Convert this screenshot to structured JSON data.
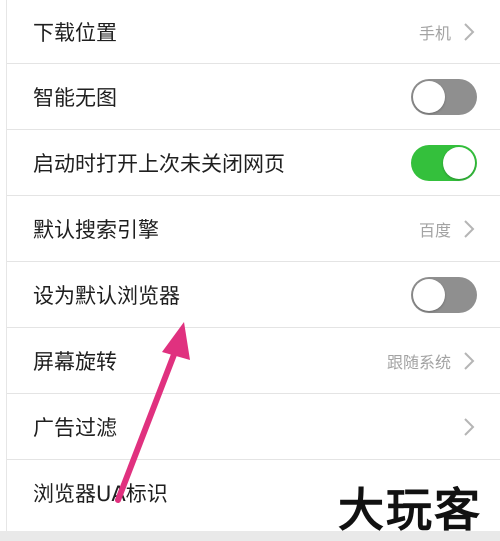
{
  "settings": {
    "items": [
      {
        "label": "下载位置",
        "value": "手机",
        "control": "chevron"
      },
      {
        "label": "智能无图",
        "control": "toggle",
        "toggle_state": "off"
      },
      {
        "label": "启动时打开上次未关闭网页",
        "control": "toggle",
        "toggle_state": "on"
      },
      {
        "label": "默认搜索引擎",
        "value": "百度",
        "control": "chevron"
      },
      {
        "label": "设为默认浏览器",
        "control": "toggle",
        "toggle_state": "off"
      },
      {
        "label": "屏幕旋转",
        "value": "跟随系统",
        "control": "chevron"
      },
      {
        "label": "广告过滤",
        "control": "chevron"
      },
      {
        "label": "浏览器UA标识"
      }
    ]
  },
  "watermark": {
    "text": "大玩客"
  },
  "colors": {
    "toggle_on": "#34c03c",
    "toggle_off": "#8f8f8f",
    "annotation_arrow": "#e0317f"
  },
  "icons": {
    "chevron": "chevron-right-icon",
    "annotation": "arrow-pointer-annotation"
  }
}
